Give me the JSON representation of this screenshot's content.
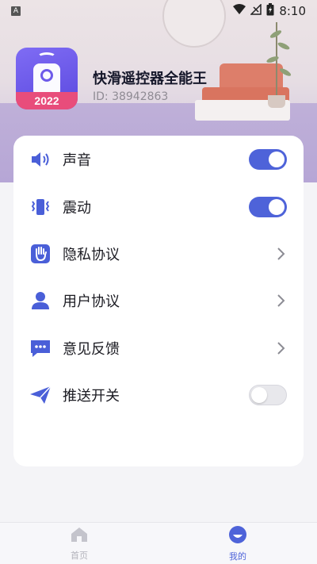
{
  "status_bar": {
    "sim_label": "A",
    "time": "8:10"
  },
  "app": {
    "name": "快滑遥控器全能王",
    "id_text": "ID: 38942863",
    "icon_year": "2022"
  },
  "settings": [
    {
      "label": "声音",
      "icon": "speaker-icon",
      "control": "toggle",
      "state": "on"
    },
    {
      "label": "震动",
      "icon": "vibration-icon",
      "control": "toggle",
      "state": "on"
    },
    {
      "label": "隐私协议",
      "icon": "hand-icon",
      "control": "chevron"
    },
    {
      "label": "用户协议",
      "icon": "user-icon",
      "control": "chevron"
    },
    {
      "label": "意见反馈",
      "icon": "chat-bubble-icon",
      "control": "chevron"
    },
    {
      "label": "推送开关",
      "icon": "paper-plane-icon",
      "control": "toggle",
      "state": "off"
    }
  ],
  "bottom_nav": [
    {
      "label": "首页",
      "icon": "home-icon",
      "active": false
    },
    {
      "label": "我的",
      "icon": "profile-icon",
      "active": true
    }
  ],
  "colors": {
    "accent": "#4e63d9",
    "icon_blue": "#4a5fd8",
    "card_bg": "#ffffff"
  }
}
